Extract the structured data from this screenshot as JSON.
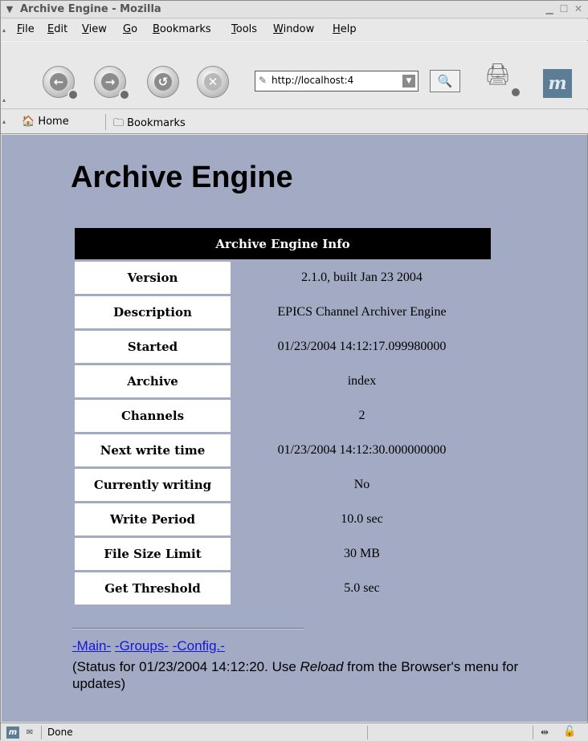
{
  "window": {
    "title": "Archive Engine - Mozilla",
    "menu_glyph": "▼",
    "minimize_glyph": "▁",
    "maximize_glyph": "☐",
    "close_glyph": "✕"
  },
  "menubar": {
    "items": [
      {
        "key": "F",
        "rest": "ile"
      },
      {
        "key": "E",
        "rest": "dit"
      },
      {
        "key": "V",
        "rest": "iew"
      },
      {
        "key": "G",
        "rest": "o"
      },
      {
        "key": "B",
        "rest": "ookmarks"
      },
      {
        "key": "T",
        "rest": "ools"
      },
      {
        "key": "W",
        "rest": "indow"
      },
      {
        "key": "H",
        "rest": "elp"
      }
    ]
  },
  "navbar": {
    "back_glyph": "←",
    "forward_glyph": "→",
    "reload_glyph": "↺",
    "stop_glyph": "✕",
    "url": "http://localhost:4",
    "url_dropdown_glyph": "▼",
    "search_glyph": "🔍",
    "print_glyph": "🖨",
    "logo_text": "m"
  },
  "personal_toolbar": {
    "home": "🏠 Home",
    "bookmarks": "🗀 Bookmarks"
  },
  "page": {
    "heading": "Archive Engine",
    "table_caption": "Archive Engine Info",
    "rows": [
      {
        "label": "Version",
        "value": "2.1.0, built Jan 23 2004"
      },
      {
        "label": "Description",
        "value": "EPICS Channel Archiver Engine"
      },
      {
        "label": "Started",
        "value": "01/23/2004 14:12:17.099980000"
      },
      {
        "label": "Archive",
        "value": "index"
      },
      {
        "label": "Channels",
        "value": "2"
      },
      {
        "label": "Next write time",
        "value": "01/23/2004 14:12:30.000000000"
      },
      {
        "label": "Currently writing",
        "value": "No"
      },
      {
        "label": "Write Period",
        "value": "10.0 sec"
      },
      {
        "label": "File Size Limit",
        "value": "30 MB"
      },
      {
        "label": "Get Threshold",
        "value": "5.0 sec"
      }
    ],
    "links": [
      {
        "label": "-Main-"
      },
      {
        "label": "-Groups-"
      },
      {
        "label": "-Config.-"
      }
    ],
    "status_before": "(Status for 01/23/2004 14:12:20. Use ",
    "status_emphasis": "Reload",
    "status_after": " from the Browser's menu for updates)"
  },
  "statusbar": {
    "moz_icon_text": "m",
    "mail_icon": "✉",
    "message": "Done",
    "connection_icon": "⇹",
    "lock_icon": "🔓"
  },
  "colors": {
    "content_background": "#a3abc4",
    "link": "#1616d8",
    "table_caption_background": "#000000"
  }
}
